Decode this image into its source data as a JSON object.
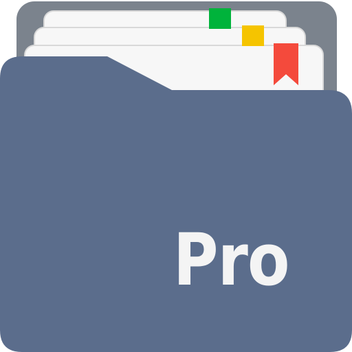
{
  "app_icon": {
    "label": "Pro",
    "icon_name": "folder-with-bookmarked-documents-icon",
    "colors": {
      "back_panel": "#7b838d",
      "folder": "#5b6d8c",
      "paper": "#f7f7f7",
      "paper_edge": "#d8d8d8",
      "tab_green": "#00b33b",
      "tab_yellow": "#f5c400",
      "bookmark_red": "#f44a3c",
      "label": "#f4f4f4"
    }
  }
}
